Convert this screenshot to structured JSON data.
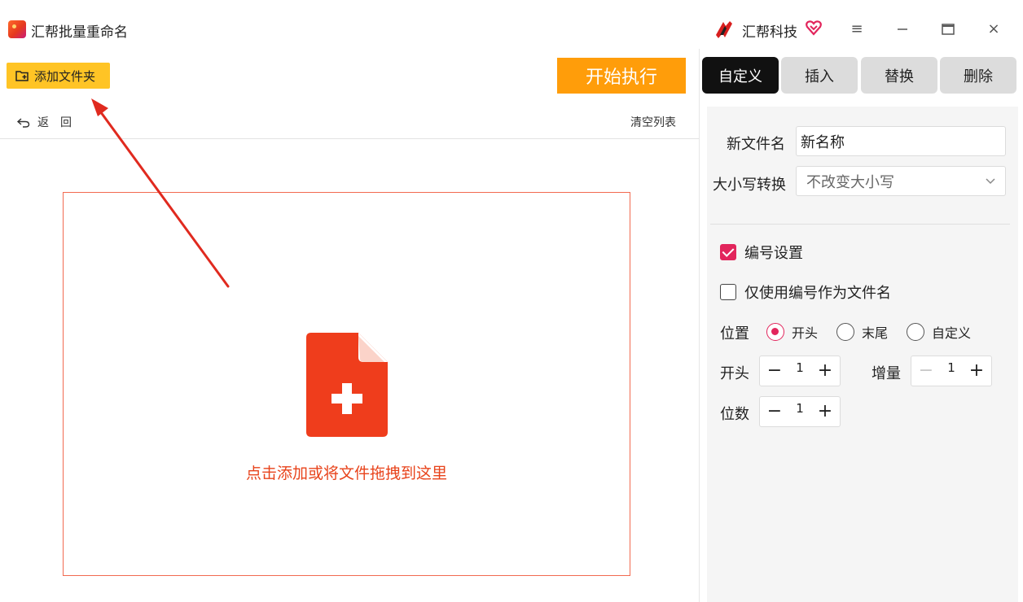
{
  "window": {
    "app_title": "汇帮批量重命名",
    "brand_name": "汇帮科技",
    "menu_icon": "hamburger-icon",
    "minimize_icon": "minimize-icon",
    "maximize_icon": "maximize-icon",
    "close_icon": "close-icon",
    "close_glyph": "×",
    "menu_glyph": "≡"
  },
  "toolbar": {
    "add_folder_label": "添加文件夹",
    "start_label": "开始执行",
    "back_label": "返回",
    "clear_list_label": "清空列表"
  },
  "dropzone": {
    "text": "点击添加或将文件拖拽到这里",
    "icon": "add-file-icon"
  },
  "tabs": [
    {
      "label": "自定义",
      "active": true
    },
    {
      "label": "插入",
      "active": false
    },
    {
      "label": "替换",
      "active": false
    },
    {
      "label": "删除",
      "active": false
    }
  ],
  "form": {
    "new_name_label": "新文件名",
    "new_name_value": "新名称",
    "case_label": "大小写转换",
    "case_value": "不改变大小写",
    "numbering_label": "编号设置",
    "numbering_checked": true,
    "only_number_label": "仅使用编号作为文件名",
    "only_number_checked": false,
    "position_label": "位置",
    "position_options": [
      "开头",
      "末尾",
      "自定义"
    ],
    "position_selected": "开头",
    "start_label": "开头",
    "start_value": "1",
    "increment_label": "增量",
    "increment_value": "1",
    "digits_label": "位数",
    "digits_value": "1",
    "minus_glyph": "−",
    "plus_glyph": "+"
  },
  "colors": {
    "accent_pink": "#e2255c",
    "start_button": "#ff9d0a",
    "add_folder_button": "#ffc425",
    "dropzone_border": "#f26a50",
    "dropzone_text": "#e8431b",
    "annotation_arrow": "#e02a1f"
  }
}
